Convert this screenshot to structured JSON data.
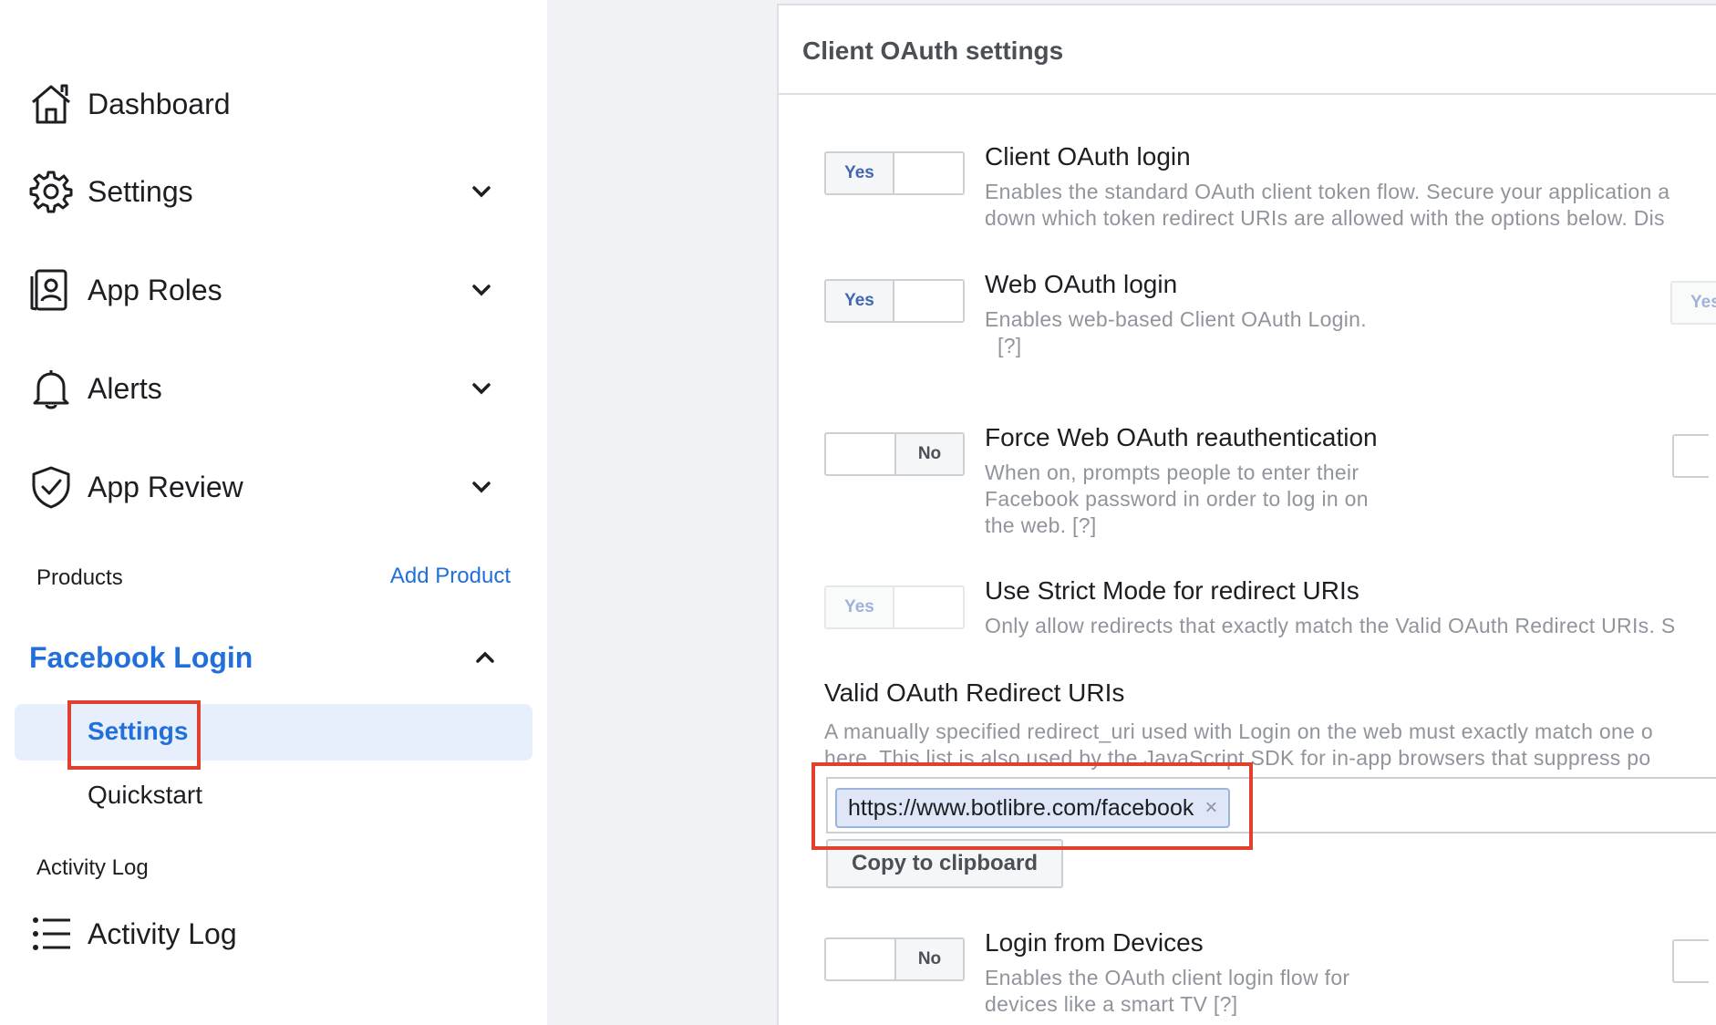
{
  "sidebar": {
    "items": [
      {
        "label": "Dashboard",
        "icon": "house-icon"
      },
      {
        "label": "Settings",
        "icon": "gear-icon"
      },
      {
        "label": "App Roles",
        "icon": "id-badge-icon"
      },
      {
        "label": "Alerts",
        "icon": "bell-icon"
      },
      {
        "label": "App Review",
        "icon": "shield-check-icon"
      }
    ],
    "products_heading": "Products",
    "add_product": "Add Product",
    "product": {
      "label": "Facebook Login",
      "sub_items": [
        {
          "label": "Settings",
          "selected": true
        },
        {
          "label": "Quickstart",
          "selected": false
        }
      ]
    },
    "activity_heading": "Activity Log",
    "activity_item": {
      "label": "Activity Log",
      "icon": "list-icon"
    }
  },
  "panel": {
    "title": "Client OAuth settings",
    "options": [
      {
        "title": "Client OAuth login",
        "desc_line1": "Enables the standard OAuth client token flow. Secure your application a",
        "desc_line2": "down which token redirect URIs are allowed with the options below. Dis",
        "toggle_on": "Yes",
        "state": "on"
      },
      {
        "title": "Web OAuth login",
        "desc_line1": "Enables web-based Client OAuth Login.",
        "desc_line2": "[?]",
        "toggle_on": "Yes",
        "state": "on"
      },
      {
        "title": "Force Web OAuth reauthentication",
        "desc_line1": "When on, prompts people to enter their",
        "desc_line2": "Facebook password in order to log in on",
        "desc_line3": "the web. [?]",
        "toggle_off": "No",
        "state": "off"
      },
      {
        "title": "Use Strict Mode for redirect URIs",
        "desc_line1": "Only allow redirects that exactly match the Valid OAuth Redirect URIs. S",
        "toggle_on": "Yes",
        "state": "on-disabled"
      }
    ],
    "redirect": {
      "title": "Valid OAuth Redirect URIs",
      "desc_line1": "A manually specified redirect_uri used with Login on the web must exactly match one o",
      "desc_line2": "here. This list is also used by the JavaScript SDK for in-app browsers that suppress po",
      "uri": "https://www.botlibre.com/facebook",
      "remove": "×",
      "copy_label": "Copy to clipboard"
    },
    "devices": {
      "title": "Login from Devices",
      "desc_line1": "Enables the OAuth client login flow for",
      "desc_line2": "devices like a smart TV [?]",
      "toggle_off": "No",
      "state": "off"
    },
    "right_col_partial": "Yes"
  },
  "colors": {
    "accent": "#216fdb",
    "highlight": "#e0412e",
    "selected_bg": "#e7effc"
  }
}
